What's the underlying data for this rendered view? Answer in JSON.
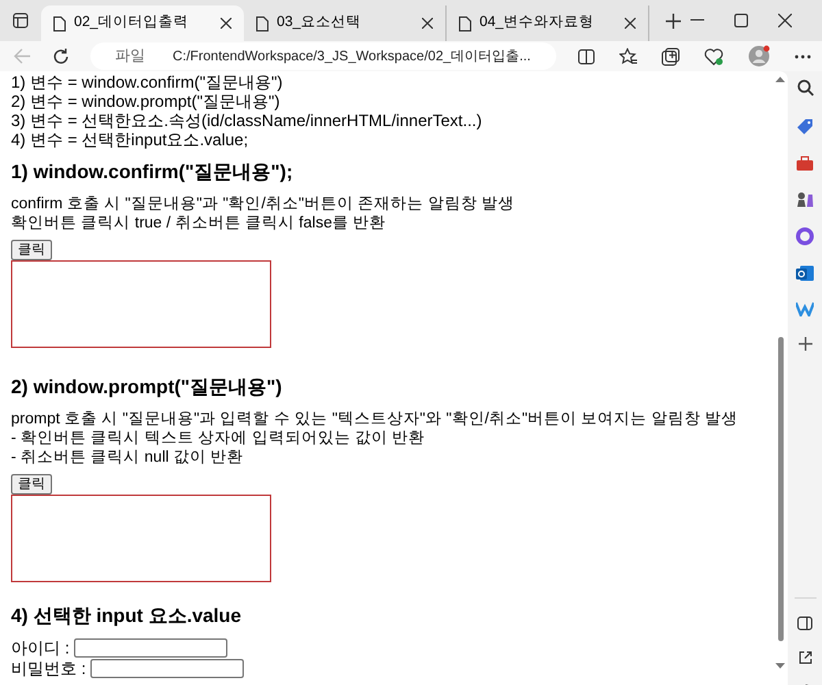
{
  "browser": {
    "tabs": [
      {
        "title": "02_데이터입출력",
        "selected": true
      },
      {
        "title": "03_요소선택",
        "selected": false
      },
      {
        "title": "04_변수와자료형",
        "selected": false
      }
    ],
    "address": {
      "scheme_label": "파일",
      "url": "C:/FrontendWorkspace/3_JS_Workspace/02_데이터입출..."
    }
  },
  "page": {
    "intro_lines": [
      "1) 변수 = window.confirm(\"질문내용\")",
      "2) 변수 = window.prompt(\"질문내용\")",
      "3) 변수 = 선택한요소.속성(id/className/innerHTML/innerText...)",
      "4) 변수 = 선택한input요소.value;"
    ],
    "sections": [
      {
        "kind": "output",
        "heading": "1) window.confirm(\"질문내용\");",
        "lines": [
          "confirm 호출 시 \"질문내용\"과 \"확인/취소\"버튼이 존재하는 알림창 발생",
          "확인버튼 클릭시 true / 취소버튼 클릭시 false를 반환"
        ],
        "button": "클릭"
      },
      {
        "kind": "output",
        "heading": "2) window.prompt(\"질문내용\")",
        "lines": [
          "prompt 호출 시 \"질문내용\"과 입력할 수 있는 \"텍스트상자\"와 \"확인/취소\"버튼이 보여지는 알림창 발생",
          "- 확인버튼 클릭시 텍스트 상자에 입력되어있는 값이 반환",
          "- 취소버튼 클릭시 null 값이 반환"
        ],
        "button": "클릭"
      },
      {
        "kind": "inputs",
        "heading": "4) 선택한 input 요소.value",
        "fields": [
          {
            "label": "아이디 :"
          },
          {
            "label": "비밀번호 :"
          }
        ]
      }
    ]
  }
}
